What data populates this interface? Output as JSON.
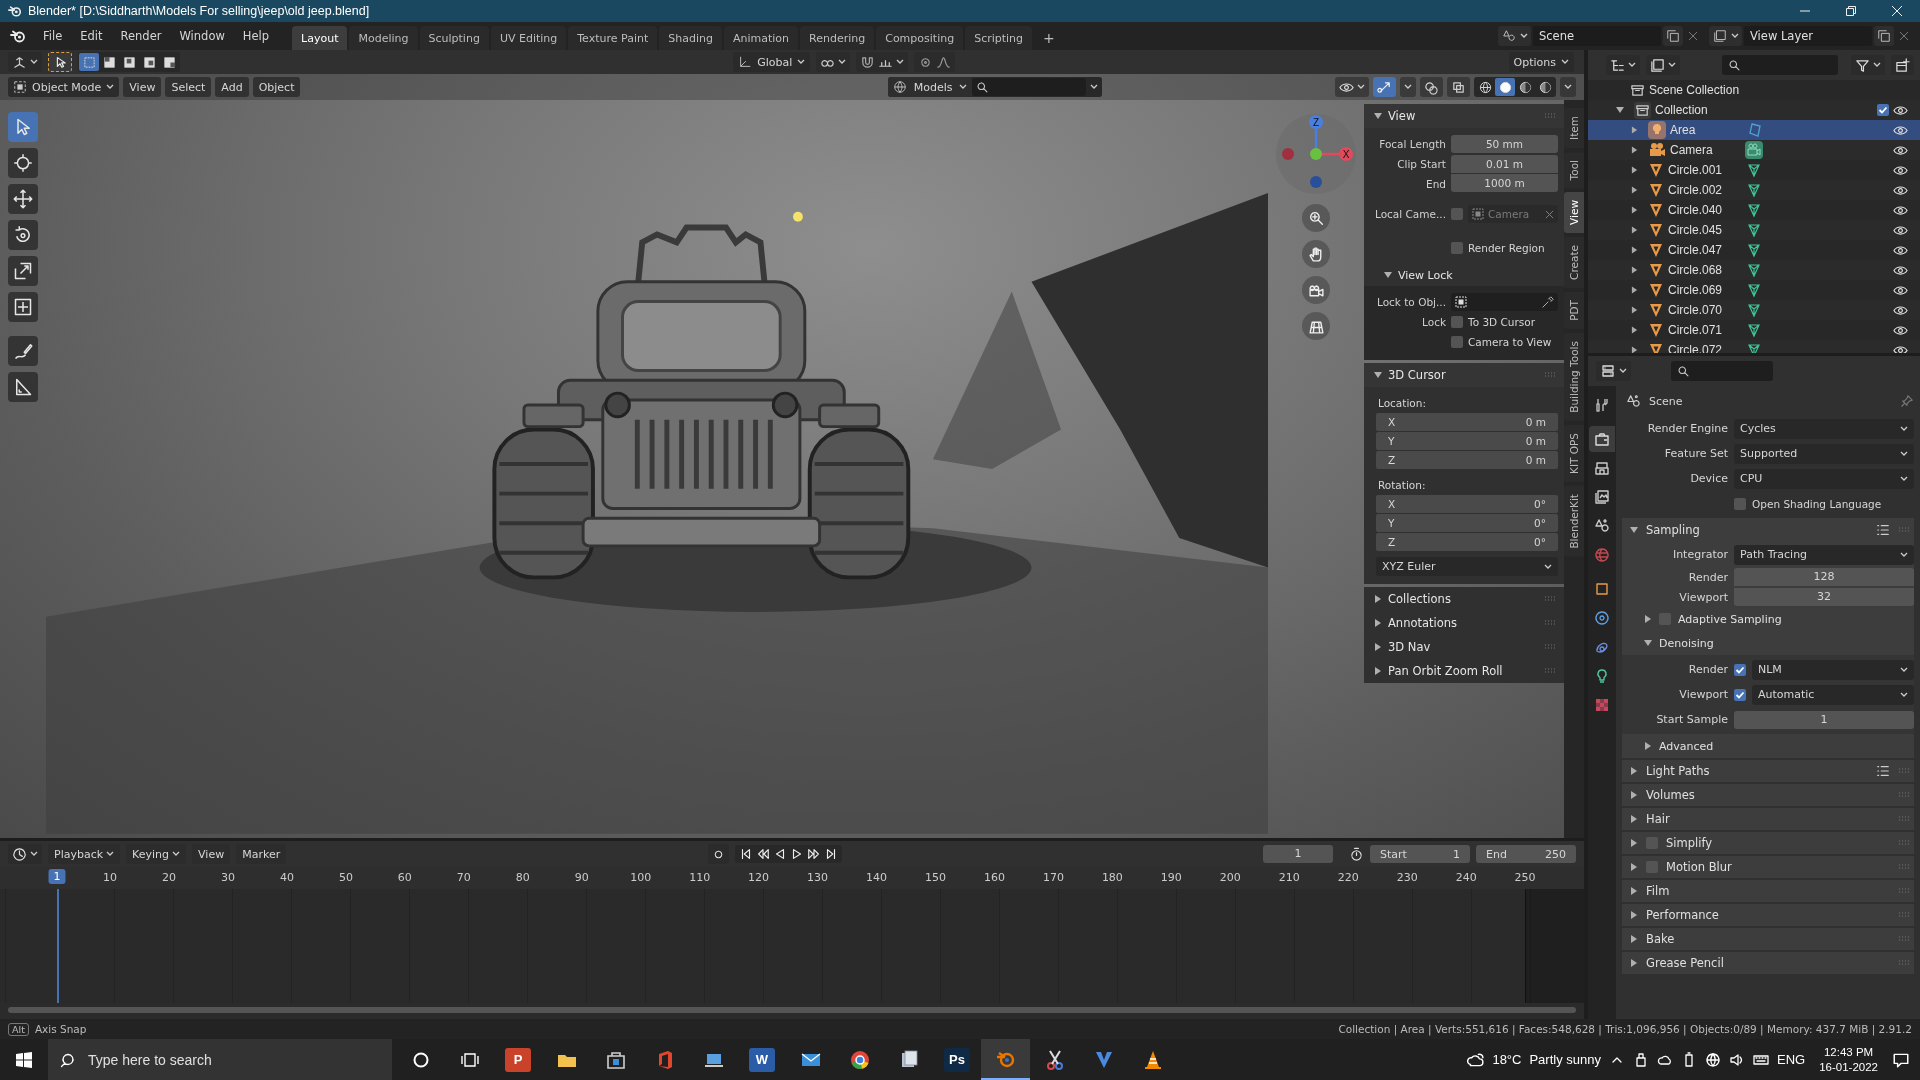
{
  "title_bar": {
    "title": "Blender* [D:\\Siddharth\\Models For selling\\jeep\\old jeep.blend]"
  },
  "menu": [
    "File",
    "Edit",
    "Render",
    "Window",
    "Help"
  ],
  "workspaces": [
    {
      "label": "Layout",
      "selected": true
    },
    {
      "label": "Modeling",
      "selected": false
    },
    {
      "label": "Sculpting",
      "selected": false
    },
    {
      "label": "UV Editing",
      "selected": false
    },
    {
      "label": "Texture Paint",
      "selected": false
    },
    {
      "label": "Shading",
      "selected": false
    },
    {
      "label": "Animation",
      "selected": false
    },
    {
      "label": "Rendering",
      "selected": false
    },
    {
      "label": "Compositing",
      "selected": false
    },
    {
      "label": "Scripting",
      "selected": false
    }
  ],
  "add_workspace": "+",
  "scene": "Scene",
  "view_layer": "View Layer",
  "viewport": {
    "transform_orientation": "Global",
    "options": "Options",
    "mode": "Object Mode",
    "menus": [
      "View",
      "Select",
      "Add",
      "Object"
    ],
    "collection": "Models",
    "gizmo_axes": [
      "Z",
      "X"
    ],
    "show_gizmo": true,
    "select_modes": [
      {
        "selected": true
      },
      {
        "selected": false
      },
      {
        "selected": false
      },
      {
        "selected": false
      },
      {
        "selected": false
      }
    ],
    "shading_modes": [
      {
        "selected": false
      },
      {
        "selected": true
      },
      {
        "selected": false
      },
      {
        "selected": false
      }
    ],
    "tools": [
      {
        "kind": "select",
        "selected": true
      },
      {
        "kind": "cursor",
        "selected": false
      },
      {
        "kind": "move",
        "selected": false
      },
      {
        "kind": "rotate",
        "selected": false
      },
      {
        "kind": "scale",
        "selected": false
      },
      {
        "kind": "transform",
        "selected": false
      },
      {
        "kind": "annotate",
        "selected": false
      },
      {
        "kind": "measure",
        "selected": false
      }
    ]
  },
  "sidebar": {
    "tabs": [
      {
        "label": "Item",
        "selected": false
      },
      {
        "label": "Tool",
        "selected": false
      },
      {
        "label": "View",
        "selected": true
      },
      {
        "label": "Create",
        "selected": false
      },
      {
        "label": "PDT",
        "selected": false
      },
      {
        "label": "Building Tools",
        "selected": false
      },
      {
        "label": "KIT OPS",
        "selected": false
      },
      {
        "label": "BlenderKit",
        "selected": false
      }
    ],
    "view": {
      "title": "View",
      "expanded": true,
      "fields": [
        {
          "label": "Focal Length",
          "value": "50 mm"
        },
        {
          "label": "Clip Start",
          "value": "0.01 m"
        },
        {
          "label": "End",
          "value": "1000 m"
        }
      ],
      "local_camera": {
        "label": "Local Came...",
        "checked": false,
        "value": "Camera"
      },
      "render_region": {
        "label": "Render Region",
        "checked": false
      }
    },
    "view_lock": {
      "title": "View Lock",
      "expanded": true,
      "lock_to_object": "Lock to Obj...",
      "lock": "Lock",
      "options": [
        {
          "label": "To 3D Cursor",
          "checked": false
        },
        {
          "label": "Camera to View",
          "checked": false
        }
      ]
    },
    "cursor": {
      "title": "3D Cursor",
      "expanded": true,
      "location_label": "Location:",
      "location": [
        {
          "axis": "X",
          "value": "0 m"
        },
        {
          "axis": "Y",
          "value": "0 m"
        },
        {
          "axis": "Z",
          "value": "0 m"
        }
      ],
      "rotation_label": "Rotation:",
      "rotation": [
        {
          "axis": "X",
          "value": "0°"
        },
        {
          "axis": "Y",
          "value": "0°"
        },
        {
          "axis": "Z",
          "value": "0°"
        }
      ],
      "rotation_mode": "XYZ Euler"
    },
    "panels": [
      {
        "title": "Collections",
        "expanded": false
      },
      {
        "title": "Annotations",
        "expanded": false
      },
      {
        "title": "3D Nav",
        "expanded": false
      },
      {
        "title": "Pan Orbit Zoom Roll",
        "expanded": false
      }
    ]
  },
  "outliner": {
    "root": "Scene Collection",
    "collection": {
      "name": "Collection",
      "expanded": true,
      "checked": true,
      "children": [
        {
          "name": "Area",
          "kind": "light",
          "selected": true
        },
        {
          "name": "Camera",
          "kind": "camera",
          "selected": false
        },
        {
          "name": "Circle.001",
          "kind": "mesh",
          "selected": false
        },
        {
          "name": "Circle.002",
          "kind": "mesh",
          "selected": false
        },
        {
          "name": "Circle.040",
          "kind": "mesh",
          "selected": false
        },
        {
          "name": "Circle.045",
          "kind": "mesh",
          "selected": false
        },
        {
          "name": "Circle.047",
          "kind": "mesh",
          "selected": false
        },
        {
          "name": "Circle.068",
          "kind": "mesh",
          "selected": false
        },
        {
          "name": "Circle.069",
          "kind": "mesh",
          "selected": false
        },
        {
          "name": "Circle.070",
          "kind": "mesh",
          "selected": false
        },
        {
          "name": "Circle.071",
          "kind": "mesh",
          "selected": false
        },
        {
          "name": "Circle.072",
          "kind": "mesh",
          "selected": false
        }
      ]
    }
  },
  "properties": {
    "tabs": [
      {
        "kind": "tool",
        "selected": false
      },
      {
        "kind": "render",
        "selected": true
      },
      {
        "kind": "output",
        "selected": false
      },
      {
        "kind": "view_layer",
        "selected": false
      },
      {
        "kind": "scene",
        "selected": false
      },
      {
        "kind": "world",
        "selected": false
      },
      {
        "kind": "object",
        "selected": false
      },
      {
        "kind": "physics",
        "selected": false
      },
      {
        "kind": "constraints",
        "selected": false
      },
      {
        "kind": "data",
        "selected": false
      },
      {
        "kind": "texture",
        "selected": false
      }
    ],
    "context": "Scene",
    "rows": [
      {
        "label": "Render Engine",
        "value": "Cycles"
      },
      {
        "label": "Feature Set",
        "value": "Supported"
      },
      {
        "label": "Device",
        "value": "CPU"
      }
    ],
    "osl": {
      "label": "Open Shading Language",
      "checked": false
    },
    "sampling": {
      "title": "Sampling",
      "expanded": true,
      "integrator": {
        "label": "Integrator",
        "value": "Path Tracing"
      },
      "samples": [
        {
          "label": "Render",
          "value": "128"
        },
        {
          "label": "Viewport",
          "value": "32"
        }
      ],
      "adaptive": {
        "label": "Adaptive Sampling",
        "checked": false,
        "expanded": false
      },
      "denoising": {
        "title": "Denoising",
        "expanded": true,
        "rows": [
          {
            "label": "Render",
            "checked": true,
            "value": "NLM"
          },
          {
            "label": "Viewport",
            "checked": true,
            "value": "Automatic"
          }
        ],
        "start_sample": {
          "label": "Start Sample",
          "value": "1"
        }
      },
      "advanced": {
        "title": "Advanced",
        "expanded": false
      }
    },
    "panels": [
      {
        "title": "Light Paths",
        "kind": "presets",
        "expanded": false
      },
      {
        "title": "Volumes",
        "kind": "plain",
        "expanded": false
      },
      {
        "title": "Hair",
        "kind": "plain",
        "expanded": false
      },
      {
        "title": "Simplify",
        "kind": "checkbox",
        "checked": false,
        "expanded": false
      },
      {
        "title": "Motion Blur",
        "kind": "checkbox",
        "checked": false,
        "expanded": false
      },
      {
        "title": "Film",
        "kind": "plain",
        "expanded": false
      },
      {
        "title": "Performance",
        "kind": "plain",
        "expanded": false
      },
      {
        "title": "Bake",
        "kind": "plain",
        "expanded": false
      },
      {
        "title": "Grease Pencil",
        "kind": "plain",
        "expanded": false
      }
    ]
  },
  "timeline": {
    "menus": [
      "Playback",
      "Keying",
      "View",
      "Marker"
    ],
    "current_frame": "1",
    "start_label": "Start",
    "start": "1",
    "end_label": "End",
    "end": "250",
    "playhead": "1",
    "ticks": [
      "10",
      "20",
      "30",
      "40",
      "50",
      "60",
      "70",
      "80",
      "90",
      "100",
      "110",
      "120",
      "130",
      "140",
      "150",
      "160",
      "170",
      "180",
      "190",
      "200",
      "210",
      "220",
      "230",
      "240",
      "250"
    ]
  },
  "status_bar": {
    "key": "Alt",
    "hint": "Axis Snap",
    "stats": "Collection | Area | Verts:551,616 | Faces:548,628 | Tris:1,096,956 | Objects:0/89 | Memory: 437.7 MiB | 2.91.2"
  },
  "taskbar": {
    "search_placeholder": "Type here to search",
    "apps": [
      {
        "kind": "explorer",
        "selected": false
      },
      {
        "kind": "store",
        "selected": false
      },
      {
        "kind": "office",
        "selected": false
      },
      {
        "kind": "laptop",
        "selected": false
      },
      {
        "kind": "word",
        "label": "W",
        "selected": false
      },
      {
        "kind": "mail",
        "selected": false
      },
      {
        "kind": "chrome",
        "selected": false
      },
      {
        "kind": "files",
        "selected": false
      },
      {
        "kind": "photoshop",
        "label": "Ps",
        "selected": false
      },
      {
        "kind": "blender",
        "selected": true
      },
      {
        "kind": "tool",
        "selected": false
      },
      {
        "kind": "vector",
        "selected": false
      },
      {
        "kind": "vlc",
        "selected": false
      }
    ],
    "pinned_first": {
      "kind": "powerpoint",
      "label": "P"
    },
    "temperature": "18°C",
    "weather": "Partly sunny",
    "language": "ENG",
    "time": "12:43 PM",
    "date": "16-01-2022"
  }
}
